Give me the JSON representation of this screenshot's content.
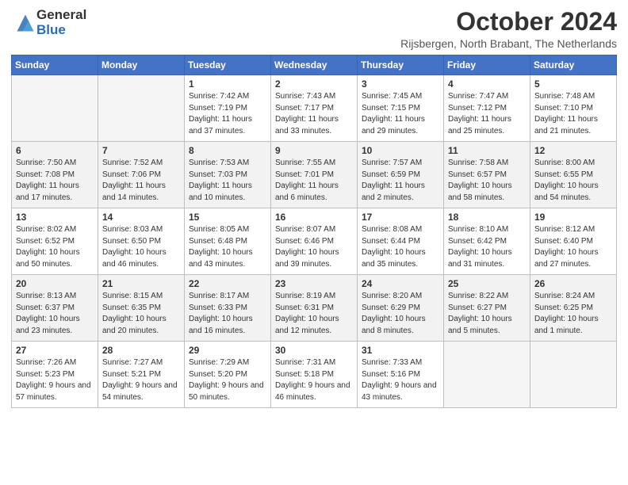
{
  "logo": {
    "general": "General",
    "blue": "Blue"
  },
  "header": {
    "month": "October 2024",
    "location": "Rijsbergen, North Brabant, The Netherlands"
  },
  "weekdays": [
    "Sunday",
    "Monday",
    "Tuesday",
    "Wednesday",
    "Thursday",
    "Friday",
    "Saturday"
  ],
  "weeks": [
    [
      {
        "day": "",
        "empty": true
      },
      {
        "day": "",
        "empty": true
      },
      {
        "day": "1",
        "sunrise": "7:42 AM",
        "sunset": "7:19 PM",
        "daylight": "11 hours and 37 minutes"
      },
      {
        "day": "2",
        "sunrise": "7:43 AM",
        "sunset": "7:17 PM",
        "daylight": "11 hours and 33 minutes"
      },
      {
        "day": "3",
        "sunrise": "7:45 AM",
        "sunset": "7:15 PM",
        "daylight": "11 hours and 29 minutes"
      },
      {
        "day": "4",
        "sunrise": "7:47 AM",
        "sunset": "7:12 PM",
        "daylight": "11 hours and 25 minutes"
      },
      {
        "day": "5",
        "sunrise": "7:48 AM",
        "sunset": "7:10 PM",
        "daylight": "11 hours and 21 minutes"
      }
    ],
    [
      {
        "day": "6",
        "sunrise": "7:50 AM",
        "sunset": "7:08 PM",
        "daylight": "11 hours and 17 minutes"
      },
      {
        "day": "7",
        "sunrise": "7:52 AM",
        "sunset": "7:06 PM",
        "daylight": "11 hours and 14 minutes"
      },
      {
        "day": "8",
        "sunrise": "7:53 AM",
        "sunset": "7:03 PM",
        "daylight": "11 hours and 10 minutes"
      },
      {
        "day": "9",
        "sunrise": "7:55 AM",
        "sunset": "7:01 PM",
        "daylight": "11 hours and 6 minutes"
      },
      {
        "day": "10",
        "sunrise": "7:57 AM",
        "sunset": "6:59 PM",
        "daylight": "11 hours and 2 minutes"
      },
      {
        "day": "11",
        "sunrise": "7:58 AM",
        "sunset": "6:57 PM",
        "daylight": "10 hours and 58 minutes"
      },
      {
        "day": "12",
        "sunrise": "8:00 AM",
        "sunset": "6:55 PM",
        "daylight": "10 hours and 54 minutes"
      }
    ],
    [
      {
        "day": "13",
        "sunrise": "8:02 AM",
        "sunset": "6:52 PM",
        "daylight": "10 hours and 50 minutes"
      },
      {
        "day": "14",
        "sunrise": "8:03 AM",
        "sunset": "6:50 PM",
        "daylight": "10 hours and 46 minutes"
      },
      {
        "day": "15",
        "sunrise": "8:05 AM",
        "sunset": "6:48 PM",
        "daylight": "10 hours and 43 minutes"
      },
      {
        "day": "16",
        "sunrise": "8:07 AM",
        "sunset": "6:46 PM",
        "daylight": "10 hours and 39 minutes"
      },
      {
        "day": "17",
        "sunrise": "8:08 AM",
        "sunset": "6:44 PM",
        "daylight": "10 hours and 35 minutes"
      },
      {
        "day": "18",
        "sunrise": "8:10 AM",
        "sunset": "6:42 PM",
        "daylight": "10 hours and 31 minutes"
      },
      {
        "day": "19",
        "sunrise": "8:12 AM",
        "sunset": "6:40 PM",
        "daylight": "10 hours and 27 minutes"
      }
    ],
    [
      {
        "day": "20",
        "sunrise": "8:13 AM",
        "sunset": "6:37 PM",
        "daylight": "10 hours and 23 minutes"
      },
      {
        "day": "21",
        "sunrise": "8:15 AM",
        "sunset": "6:35 PM",
        "daylight": "10 hours and 20 minutes"
      },
      {
        "day": "22",
        "sunrise": "8:17 AM",
        "sunset": "6:33 PM",
        "daylight": "10 hours and 16 minutes"
      },
      {
        "day": "23",
        "sunrise": "8:19 AM",
        "sunset": "6:31 PM",
        "daylight": "10 hours and 12 minutes"
      },
      {
        "day": "24",
        "sunrise": "8:20 AM",
        "sunset": "6:29 PM",
        "daylight": "10 hours and 8 minutes"
      },
      {
        "day": "25",
        "sunrise": "8:22 AM",
        "sunset": "6:27 PM",
        "daylight": "10 hours and 5 minutes"
      },
      {
        "day": "26",
        "sunrise": "8:24 AM",
        "sunset": "6:25 PM",
        "daylight": "10 hours and 1 minute"
      }
    ],
    [
      {
        "day": "27",
        "sunrise": "7:26 AM",
        "sunset": "5:23 PM",
        "daylight": "9 hours and 57 minutes"
      },
      {
        "day": "28",
        "sunrise": "7:27 AM",
        "sunset": "5:21 PM",
        "daylight": "9 hours and 54 minutes"
      },
      {
        "day": "29",
        "sunrise": "7:29 AM",
        "sunset": "5:20 PM",
        "daylight": "9 hours and 50 minutes"
      },
      {
        "day": "30",
        "sunrise": "7:31 AM",
        "sunset": "5:18 PM",
        "daylight": "9 hours and 46 minutes"
      },
      {
        "day": "31",
        "sunrise": "7:33 AM",
        "sunset": "5:16 PM",
        "daylight": "9 hours and 43 minutes"
      },
      {
        "day": "",
        "empty": true
      },
      {
        "day": "",
        "empty": true
      }
    ]
  ]
}
